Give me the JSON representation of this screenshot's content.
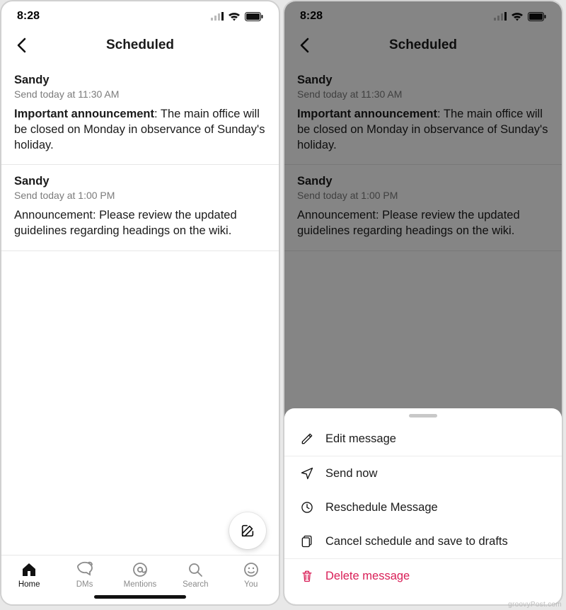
{
  "status": {
    "time": "8:28"
  },
  "header": {
    "title": "Scheduled"
  },
  "messages": [
    {
      "sender": "Sandy",
      "time": "Send today at 11:30 AM",
      "body_bold": "Important announcement",
      "body_rest": ": The main office will be closed on Monday in observance of Sunday's holiday."
    },
    {
      "sender": "Sandy",
      "time": "Send today at 1:00 PM",
      "body_bold": "",
      "body_rest": "Announcement: Please review the updated guidelines regarding headings on the wiki."
    }
  ],
  "tabs": {
    "home": "Home",
    "dms": "DMs",
    "mentions": "Mentions",
    "search": "Search",
    "you": "You"
  },
  "sheet": {
    "edit": "Edit message",
    "send": "Send now",
    "reschedule": "Reschedule Message",
    "cancel": "Cancel schedule and save to drafts",
    "delete": "Delete message"
  },
  "watermark": "groovyPost.com"
}
